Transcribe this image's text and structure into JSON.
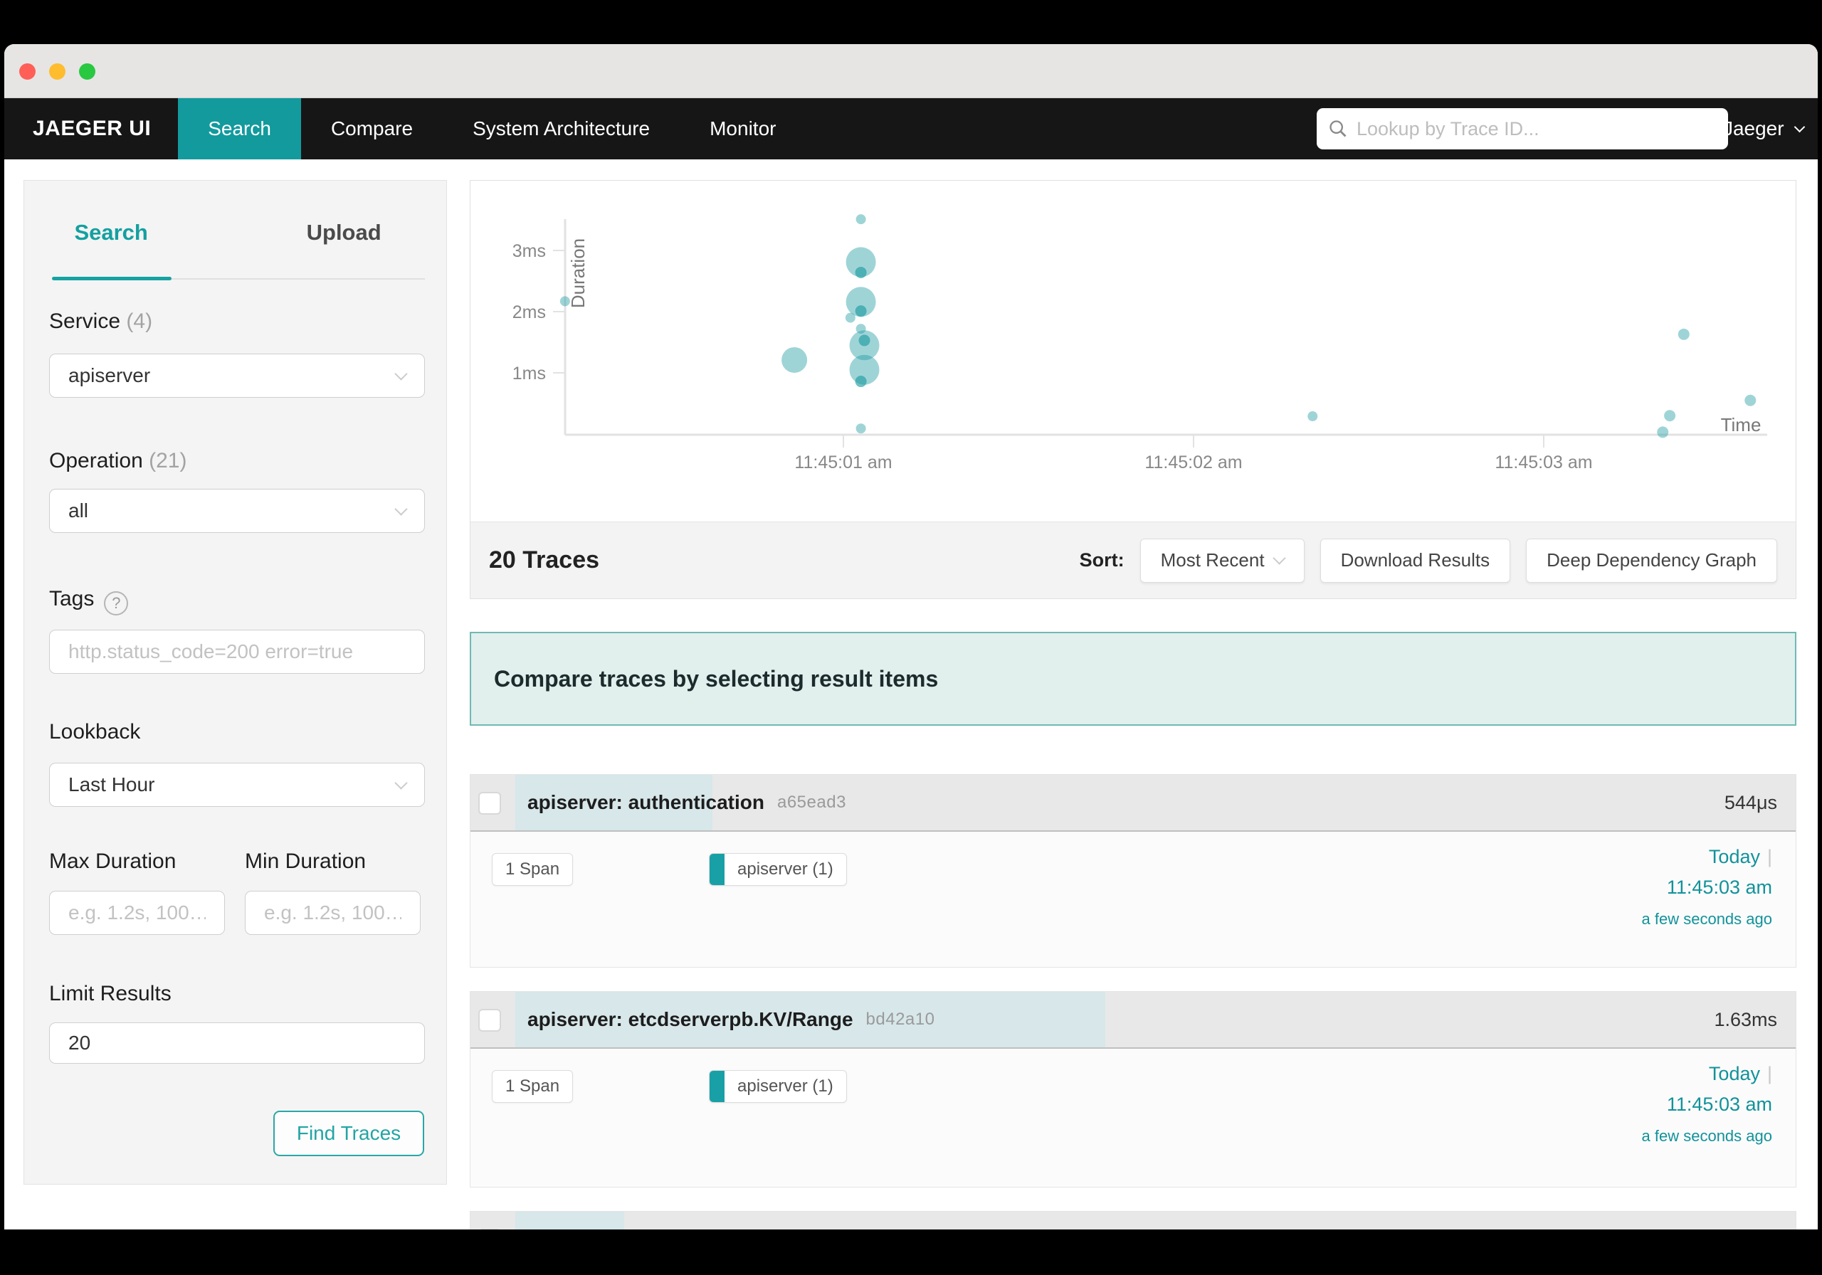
{
  "titlebar": {
    "close_color": "#ff5f57",
    "minimize_color": "#febc2e",
    "zoom_color": "#28c840"
  },
  "navbar": {
    "brand": "JAEGER UI",
    "tabs": [
      {
        "label": "Search",
        "active": true
      },
      {
        "label": "Compare",
        "active": false
      },
      {
        "label": "System Architecture",
        "active": false
      },
      {
        "label": "Monitor",
        "active": false
      }
    ],
    "trace_lookup_placeholder": "Lookup by Trace ID...",
    "about_menu": "About Jaeger"
  },
  "search_panel": {
    "tabs": [
      {
        "label": "Search",
        "active": true
      },
      {
        "label": "Upload",
        "active": false
      }
    ],
    "service": {
      "label": "Service",
      "count": "(4)",
      "value": "apiserver"
    },
    "operation": {
      "label": "Operation",
      "count": "(21)",
      "value": "all"
    },
    "tags": {
      "label": "Tags",
      "placeholder": "http.status_code=200 error=true"
    },
    "lookback": {
      "label": "Lookback",
      "value": "Last Hour"
    },
    "max_duration": {
      "label": "Max Duration",
      "placeholder": "e.g. 1.2s, 100…"
    },
    "min_duration": {
      "label": "Min Duration",
      "placeholder": "e.g. 1.2s, 100…"
    },
    "limit": {
      "label": "Limit Results",
      "value": "20"
    },
    "find_traces_button": "Find Traces"
  },
  "results": {
    "heading": "20 Traces",
    "sort_label": "Sort:",
    "sort_value": "Most Recent",
    "download_results_button": "Download Results",
    "deep_dependency_graph_button": "Deep Dependency Graph",
    "compare_banner": "Compare traces by selecting result items",
    "max_duration_ms": 3.66,
    "traces": [
      {
        "title": "apiserver: authentication",
        "trace_id": "a65ead3",
        "duration": "544μs",
        "duration_ms": 0.544,
        "span_count": "1 Span",
        "service_chip": "apiserver (1)",
        "date": "Today",
        "separator": "|",
        "time": "11:45:03 am",
        "relative_time": "a few seconds ago"
      },
      {
        "title": "apiserver: etcdserverpb.KV/Range",
        "trace_id": "bd42a10",
        "duration": "1.63ms",
        "duration_ms": 1.63,
        "span_count": "1 Span",
        "service_chip": "apiserver (1)",
        "date": "Today",
        "separator": "|",
        "time": "11:45:03 am",
        "relative_time": "a few seconds ago"
      },
      {
        "title": "",
        "trace_id": "",
        "duration": "",
        "duration_ms": 0.3,
        "partial": true
      }
    ]
  },
  "chart_data": {
    "type": "scatter",
    "xlabel": "Time",
    "ylabel": "Duration",
    "x_base_time": "11:45:00 am",
    "x_ticks": [
      {
        "t": 1,
        "label": "11:45:01 am"
      },
      {
        "t": 2,
        "label": "11:45:02 am"
      },
      {
        "t": 3,
        "label": "11:45:03 am"
      }
    ],
    "y_ticks": [
      {
        "ms": 1,
        "label": "1ms"
      },
      {
        "ms": 2,
        "label": "2ms"
      },
      {
        "ms": 3,
        "label": "3ms"
      }
    ],
    "points": [
      {
        "t": 0.205,
        "ms": 2.17,
        "r": 7
      },
      {
        "t": 0.86,
        "ms": 1.21,
        "r": 18
      },
      {
        "t": 1.05,
        "ms": 3.51,
        "r": 7
      },
      {
        "t": 1.05,
        "ms": 2.81,
        "r": 21
      },
      {
        "t": 1.05,
        "ms": 2.64,
        "r": 8,
        "dark": true
      },
      {
        "t": 1.05,
        "ms": 2.16,
        "r": 21
      },
      {
        "t": 1.05,
        "ms": 2.01,
        "r": 8,
        "dark": true
      },
      {
        "t": 1.02,
        "ms": 1.9,
        "r": 7
      },
      {
        "t": 1.05,
        "ms": 1.72,
        "r": 7
      },
      {
        "t": 1.06,
        "ms": 1.53,
        "r": 8,
        "dark": true
      },
      {
        "t": 1.06,
        "ms": 1.45,
        "r": 21
      },
      {
        "t": 1.06,
        "ms": 1.05,
        "r": 21
      },
      {
        "t": 1.05,
        "ms": 0.86,
        "r": 8,
        "dark": true
      },
      {
        "t": 1.05,
        "ms": 0.09,
        "r": 7
      },
      {
        "t": 2.34,
        "ms": 0.29,
        "r": 7
      },
      {
        "t": 3.4,
        "ms": 1.63,
        "r": 8
      },
      {
        "t": 3.36,
        "ms": 0.3,
        "r": 8
      },
      {
        "t": 3.34,
        "ms": 0.03,
        "r": 8
      },
      {
        "t": 3.59,
        "ms": 0.55,
        "r": 8
      }
    ],
    "point_color": "#1a99a0",
    "grid_color": "#e2e2e2",
    "tick_label_color": "#888888",
    "axis_title_color": "#777777"
  },
  "colors": {
    "accent_teal": "#129a9d",
    "link_teal": "#12929a",
    "navbar_bg": "#161616",
    "banner_bg": "#e1efed",
    "banner_border": "#70b9b4",
    "duration_bar": "#d7e7ea"
  }
}
